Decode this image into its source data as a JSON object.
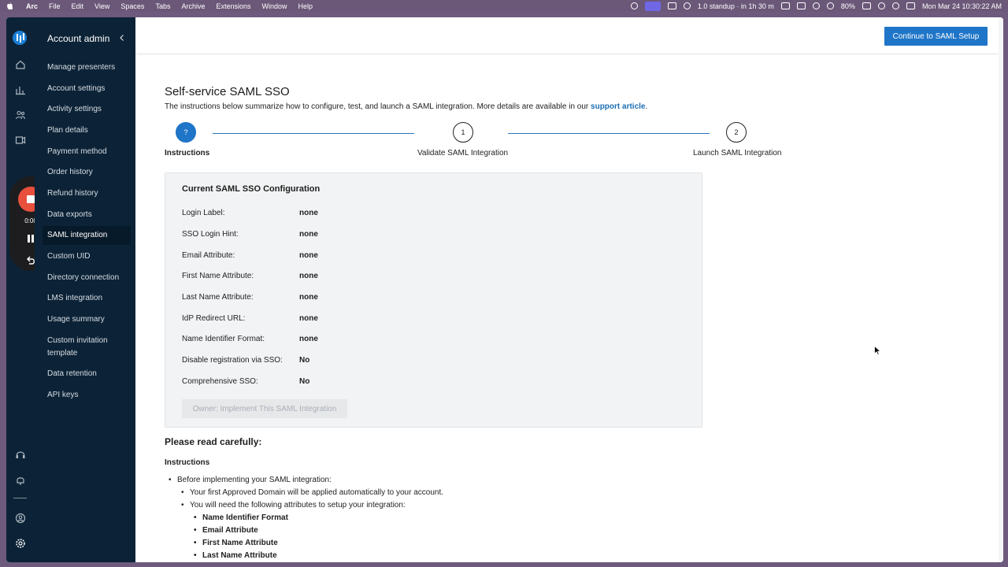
{
  "menubar": {
    "app": "Arc",
    "menus": [
      "File",
      "Edit",
      "View",
      "Spaces",
      "Tabs",
      "Archive",
      "Extensions",
      "Window",
      "Help"
    ],
    "meeting": "1.0 standup · in 1h 30 m",
    "battery": "80%",
    "datetime": "Mon Mar 24  10:30:22 AM"
  },
  "sidebar": {
    "title": "Account admin",
    "items": [
      "Manage presenters",
      "Account settings",
      "Activity settings",
      "Plan details",
      "Payment method",
      "Order history",
      "Refund history",
      "Data exports",
      "SAML integration",
      "Custom UID",
      "Directory connection",
      "LMS integration",
      "Usage summary",
      "Custom invitation template",
      "Data retention",
      "API keys"
    ],
    "active_item": "SAML integration"
  },
  "recorder": {
    "time": "0:00"
  },
  "topbar": {
    "continue_label": "Continue to SAML Setup"
  },
  "page": {
    "title": "Self-service SAML SSO",
    "subtitle_prefix": "The instructions below summarize how to configure, test, and launch a SAML integration. More details are available in our ",
    "subtitle_link": "support article",
    "subtitle_suffix": "."
  },
  "stepper": [
    {
      "marker": "?",
      "label": "Instructions",
      "current": true
    },
    {
      "marker": "1",
      "label": "Validate SAML Integration",
      "current": false
    },
    {
      "marker": "2",
      "label": "Launch SAML Integration",
      "current": false
    }
  ],
  "config": {
    "title": "Current SAML SSO Configuration",
    "rows": [
      {
        "label": "Login Label:",
        "value": "none"
      },
      {
        "label": "SSO Login Hint:",
        "value": "none"
      },
      {
        "label": "Email Attribute:",
        "value": "none"
      },
      {
        "label": "First Name Attribute:",
        "value": "none"
      },
      {
        "label": "Last Name Attribute:",
        "value": "none"
      },
      {
        "label": "IdP Redirect URL:",
        "value": "none"
      },
      {
        "label": "Name Identifier Format:",
        "value": "none"
      },
      {
        "label": "Disable registration via SSO:",
        "value": "No"
      },
      {
        "label": "Comprehensive SSO:",
        "value": "No"
      }
    ],
    "owner_button": "Owner: Implement This SAML Integration"
  },
  "instructions": {
    "read_carefully": "Please read carefully:",
    "heading": "Instructions",
    "bullet_1": "Before implementing your SAML integration:",
    "bullet_1a": "Your first Approved Domain will be applied automatically to your account.",
    "bullet_1b": "You will need the following attributes to setup your integration:",
    "attributes": [
      "Name Identifier Format",
      "Email Attribute",
      "First Name Attribute",
      "Last Name Attribute"
    ]
  }
}
